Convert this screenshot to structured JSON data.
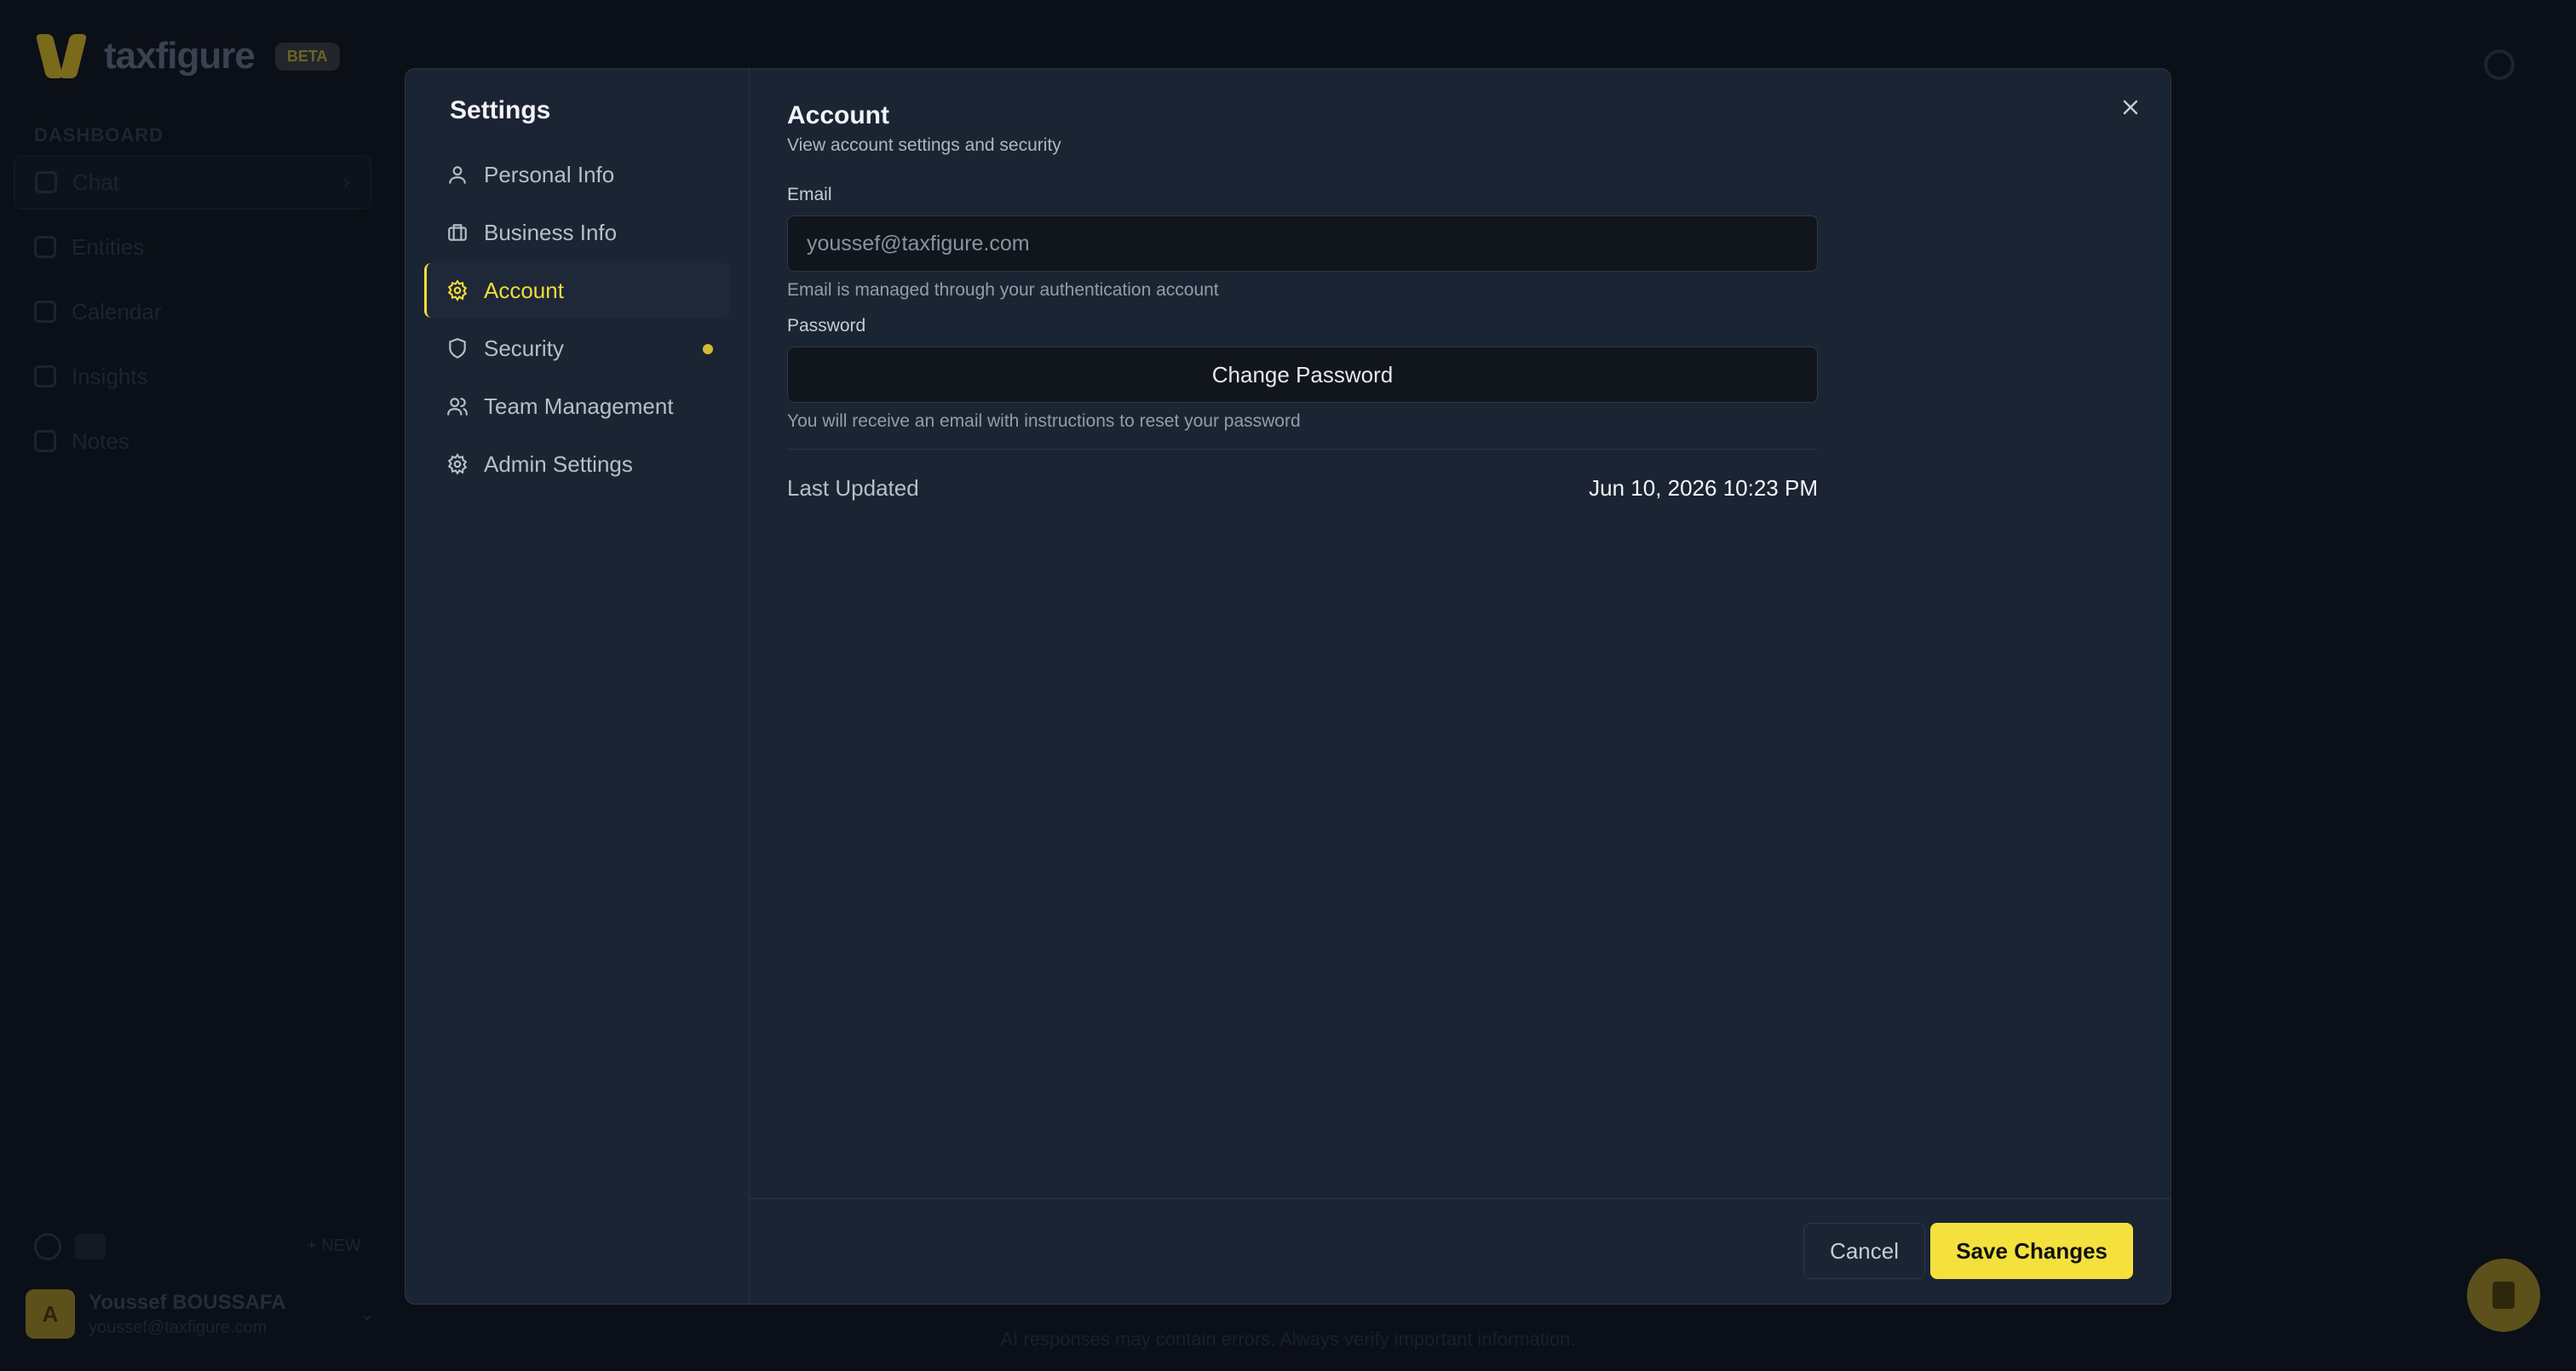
{
  "app": {
    "logo_text": "taxfigure",
    "beta_badge": "BETA",
    "section_label": "DASHBOARD",
    "nav": [
      {
        "label": "Chat",
        "icon": "chat-icon"
      },
      {
        "label": "Entities",
        "icon": "database-icon"
      },
      {
        "label": "Calendar",
        "icon": "calendar-icon"
      },
      {
        "label": "Insights",
        "icon": "lightbulb-icon"
      },
      {
        "label": "Notes",
        "icon": "notes-icon"
      }
    ],
    "new_chat_label": "+ NEW",
    "user": {
      "initial": "A",
      "name": "Youssef BOUSSAFA",
      "email": "youssef@taxfigure.com"
    },
    "footer_note": "AI responses may contain errors. Always verify important information."
  },
  "settings": {
    "title": "Settings",
    "menu": [
      {
        "label": "Personal Info",
        "icon": "user-icon"
      },
      {
        "label": "Business Info",
        "icon": "briefcase-icon"
      },
      {
        "label": "Account",
        "icon": "gear-icon",
        "active": true
      },
      {
        "label": "Security",
        "icon": "shield-icon",
        "has_dot": true
      },
      {
        "label": "Team Management",
        "icon": "users-icon"
      },
      {
        "label": "Admin Settings",
        "icon": "gear-icon"
      }
    ],
    "accent_color": "#f4e13e",
    "account": {
      "title": "Account",
      "subtitle": "View account settings and security",
      "email_label": "Email",
      "email_value": "youssef@taxfigure.com",
      "email_help": "Email is managed through your authentication account",
      "password_label": "Password",
      "change_password_label": "Change Password",
      "password_help": "You will receive an email with instructions to reset your password",
      "last_updated_label": "Last Updated",
      "last_updated_value": "Jun 10, 2026 10:23 PM"
    },
    "footer": {
      "cancel_label": "Cancel",
      "save_label": "Save Changes"
    }
  }
}
